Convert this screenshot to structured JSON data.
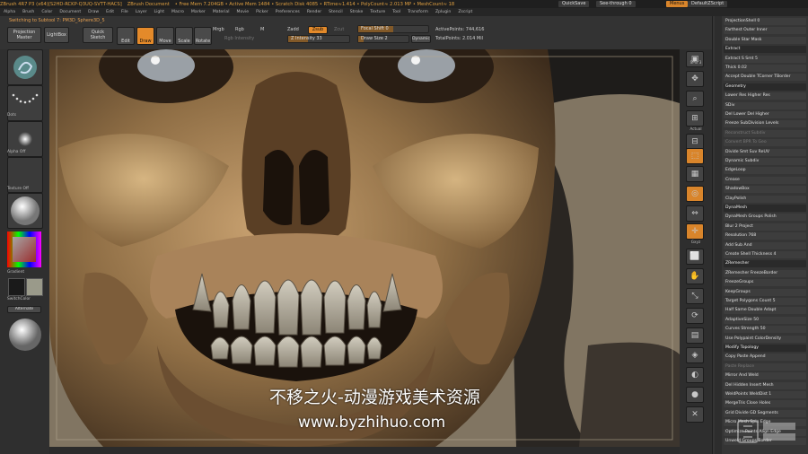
{
  "titlebar": {
    "segments": [
      "ZBrush 4R7 P3 (x64)[S2HD-RCKP-Q3UQ-SVTT-HACS]",
      "ZBrush Document",
      "• Free Mem 7.204GB • Active Mem 1484 • Scratch Disk 4085 • RTime≈1.414 • PolyCount≈ 2.013 MP • MeshCount≈ 18"
    ],
    "quicksave": "QuickSave",
    "seethrough": "See-through  0",
    "menus": "Menus",
    "defaultscript": "DefaultZScript"
  },
  "menubar": [
    "Alpha",
    "Brush",
    "Color",
    "Document",
    "Draw",
    "Edit",
    "File",
    "Layer",
    "Light",
    "Macro",
    "Marker",
    "Material",
    "Movie",
    "Picker",
    "Preferences",
    "Render",
    "Stencil",
    "Stroke",
    "Texture",
    "Tool",
    "Transform",
    "Zplugin",
    "Zscript"
  ],
  "shelf": {
    "switching": "Switching to Subtool 7:  PM3D_Sphere3D_5",
    "projection_master": "Projection Master",
    "lightbox": "LightBox",
    "quick_sketch": "Quick Sketch",
    "edit": "Edit",
    "draw": "Draw",
    "move": "Move",
    "scale": "Scale",
    "rotate": "Rotate",
    "mrgb": "Mrgb",
    "rgb": "Rgb",
    "m": "M",
    "rgb_intensity": "Rgb Intensity",
    "zadd": "Zadd",
    "zsub": "Zsub",
    "zcut": "Zcut",
    "z_intensity": "Z Intensity 33",
    "z_intensity_value": 33,
    "focal_shift": "Focal Shift 0",
    "draw_size": "Draw Size 2",
    "dynamic": "Dynamic",
    "active_points": "ActivePoints: 744,616",
    "total_points": "TotalPoints: 2.014 Mil"
  },
  "lefttray": {
    "labels": [
      "",
      "Dots",
      "Alpha Off",
      "Texture Off",
      "Gradient",
      "SwitchColor",
      "Alternate"
    ],
    "color_swatch_main": "#1a1a1a",
    "color_swatch_secondary": "#9a9a8a"
  },
  "toolcol": {
    "items": [
      "BPR",
      "SPix 3",
      "Scroll",
      "Zoom",
      "Actual",
      "AAHalf",
      "Persp",
      "Floor",
      "Local",
      "L.Sym",
      "Gxyz",
      "Frame",
      "Move",
      "Scale",
      "Rotate",
      "Line Fill",
      "PolyF",
      "Transp",
      "Ghost",
      "Solo",
      "Xpose"
    ]
  },
  "palette": {
    "rows": [
      "ProjectionShell 0",
      "Farthest  Outer  Inner",
      "Double  Star  Mask",
      "Extract",
      "Extract  S Smt 5",
      "         Thick 0.02",
      "Accept  Double  TCorner  TBorder",
      "Geometry",
      "Lower Res  Higher Res",
      "SDiv",
      "Del Lower  Del Higher",
      "Freeze SubDivision Levels",
      "Reconstruct Subdiv",
      "Convert BPR To Geo",
      "Divide  Smt  Suv  ReUV",
      "Dynamic Subdiv",
      "EdgeLoop",
      "Crease",
      "ShadowBox",
      "ClayPolish",
      "DynaMesh",
      "DynaMesh  Groups  Polish",
      "           Blur 2  Project",
      "Resolution 768",
      "Add  Sub  And",
      "Create Shell  Thickness 4",
      "ZRemesher",
      "ZRemesher  FreezeBorder",
      "           FreezeGroups",
      "           KeepGroups",
      "Target Polygons Count 5",
      "Half  Same  Double  Adapt",
      "AdaptiveSize 50",
      "Curves Strength 50",
      "Use Polypaint  ColorDensity",
      "Modify Topology",
      "Copy  Paste Append",
      "      Paste Replace",
      "Mirror And Weld",
      "Del Hidden  Insert Mesh",
      "WeldPoints  WeldDist 1",
      "MergeTris  Close Holes",
      "Grid Divide  GD Segments",
      "Micro Mesh  Spin Edge",
      "Optimize Points  Align Edge",
      "Unweld Groups Border"
    ]
  },
  "watermark": {
    "line1": "不移之火-动漫游戏美术资源",
    "line2": "www.byzhihuo.com"
  }
}
